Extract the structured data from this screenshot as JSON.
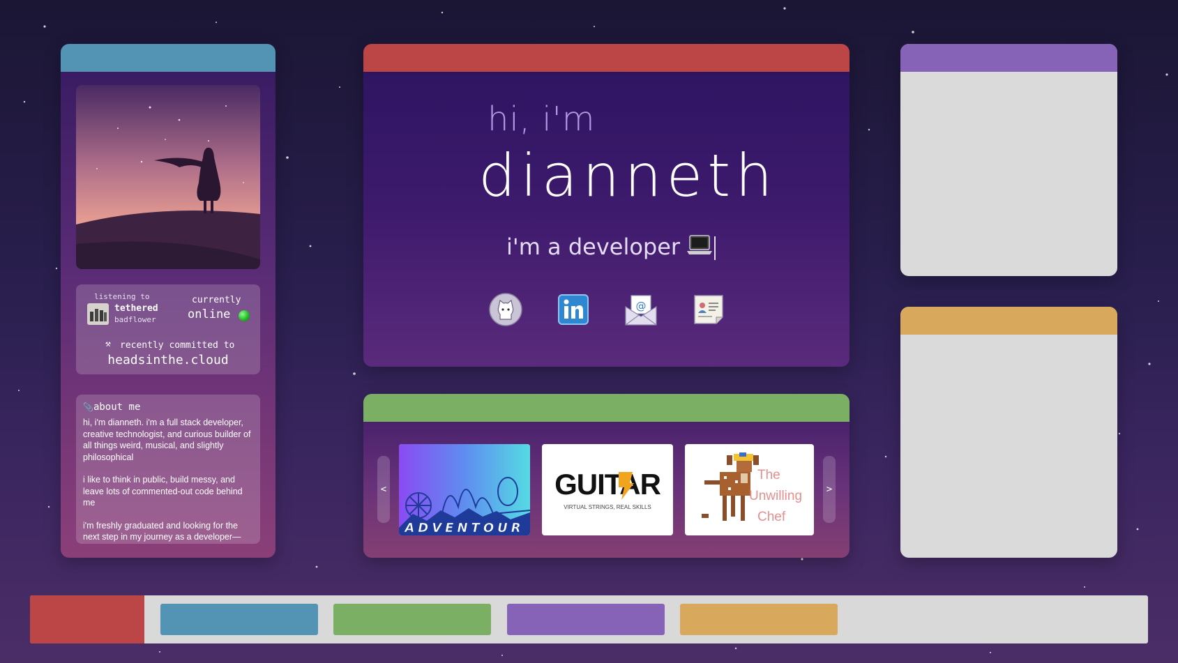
{
  "hero": {
    "greeting": "hi, i'm",
    "name": "dianneth",
    "role": "i'm a developer",
    "social": [
      {
        "icon": "github-icon",
        "label": "GitHub"
      },
      {
        "icon": "linkedin-icon",
        "label": "LinkedIn"
      },
      {
        "icon": "email-icon",
        "label": "Email"
      },
      {
        "icon": "resume-icon",
        "label": "Resume"
      }
    ]
  },
  "status": {
    "listening_label": "listening to",
    "song": "tethered",
    "artist": "badflower",
    "currently_label": "currently",
    "online_text": "online",
    "commit_label": "recently committed to",
    "repo": "headsinthe.cloud"
  },
  "about": {
    "title": "about me",
    "paragraphs": [
      "hi, i'm dianneth. i'm a full stack developer, creative technologist, and curious builder of all things weird, musical, and slightly philosophical",
      "i like to think in public, build messy, and leave lots of commented-out code behind me",
      "i'm freshly graduated and looking for the next step in my journey as a developer—"
    ]
  },
  "projects": {
    "prev_label": "<",
    "next_label": ">",
    "items": [
      {
        "name": "ADVENTOUR"
      },
      {
        "name": "GUITAR",
        "tagline": "VIRTUAL STRINGS, REAL SKILLS"
      },
      {
        "name_lines": [
          "The",
          "Unwilling",
          "Chef"
        ]
      }
    ]
  },
  "colors": {
    "red": "#bc4545",
    "blue": "#5393b3",
    "green": "#7bb064",
    "purple": "#8763b8",
    "orange": "#d8a95c",
    "window_gray": "#dadada"
  }
}
